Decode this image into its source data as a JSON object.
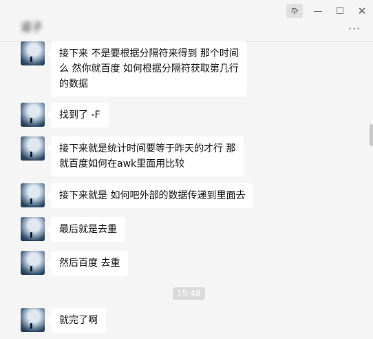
{
  "window": {
    "title": "诺子",
    "pin_glyph": "卆",
    "min_glyph": "—",
    "max_glyph": "☐",
    "close_glyph": "✕",
    "more_glyph": "···"
  },
  "messages": [
    {
      "lines": [
        "接下来 不是要根据分隔符来得到 那个时间",
        "么  然你就百度 如何根据分隔符获取第几行",
        "的数据"
      ]
    },
    {
      "lines": [
        "找到了 -F"
      ]
    },
    {
      "lines": [
        "接下来就是统计时间要等于昨天的才行  那",
        "就百度如何在awk里面用比较"
      ]
    },
    {
      "lines": [
        "接下来就是 如何吧外部的数据传递到里面去"
      ]
    },
    {
      "lines": [
        "最后就是去重"
      ]
    },
    {
      "lines": [
        "然后百度 去重"
      ]
    },
    {
      "lines": [
        "就完了啊"
      ]
    }
  ],
  "timestamp": "15:48"
}
